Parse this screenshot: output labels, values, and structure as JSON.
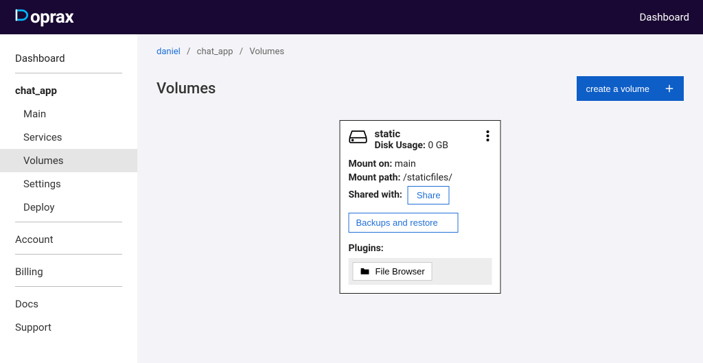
{
  "top": {
    "brand": "oprax",
    "dashboard_link": "Dashboard"
  },
  "sidebar": {
    "dashboard": "Dashboard",
    "app_name": "chat_app",
    "sub": {
      "main": "Main",
      "services": "Services",
      "volumes": "Volumes",
      "settings": "Settings",
      "deploy": "Deploy"
    },
    "account": "Account",
    "billing": "Billing",
    "docs": "Docs",
    "support": "Support"
  },
  "breadcrumb": {
    "user": "daniel",
    "app": "chat_app",
    "page": "Volumes"
  },
  "page": {
    "title": "Volumes",
    "create_label": "create a volume"
  },
  "volume": {
    "name": "static",
    "disk_usage_label": "Disk Usage:",
    "disk_usage_value": "0 GB",
    "mount_on_label": "Mount on:",
    "mount_on_value": "main",
    "mount_path_label": "Mount path:",
    "mount_path_value": "/staticfiles/",
    "shared_with_label": "Shared with:",
    "share_btn": "Share",
    "backups_btn": "Backups and restore",
    "plugins_label": "Plugins:",
    "plugin_file_browser": "File Browser"
  }
}
